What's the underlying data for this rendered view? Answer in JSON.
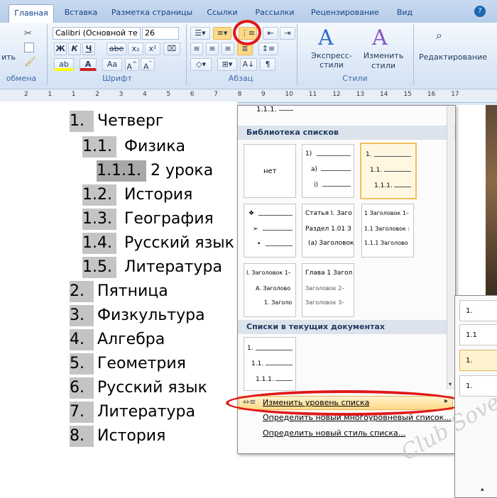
{
  "ribbon": {
    "tabs": [
      {
        "label": "Главная",
        "active": true
      },
      {
        "label": "Вставка"
      },
      {
        "label": "Разметка страницы"
      },
      {
        "label": "Ссылки"
      },
      {
        "label": "Рассылки"
      },
      {
        "label": "Рецензирование"
      },
      {
        "label": "Вид"
      }
    ],
    "left_cut_label": "ить",
    "font_name": "Calibri (Основной те",
    "font_size": "26",
    "font_buttons": [
      "Ж",
      "К",
      "Ч",
      "abe",
      "x₂",
      "x²",
      "Aa"
    ],
    "express_styles": "Экспресс-стили",
    "change_styles": "Изменить стили",
    "editing": "Редактирование",
    "groups": {
      "clipboard": "обмена",
      "font": "Шрифт",
      "paragraph": "Абзац",
      "styles": "Стили"
    }
  },
  "ruler": {
    "numbers": [
      "2",
      "1",
      "1",
      "2",
      "3",
      "4",
      "5",
      "6",
      "7",
      "8",
      "9",
      "10",
      "11",
      "12",
      "13",
      "14",
      "15",
      "16",
      "17"
    ]
  },
  "document": {
    "items": [
      {
        "num": "1.",
        "text": "Четверг"
      },
      {
        "num": "1.1.",
        "text": "Физика"
      },
      {
        "num": "1.1.1.",
        "text": "2 урока"
      },
      {
        "num": "1.2.",
        "text": "История"
      },
      {
        "num": "1.3.",
        "text": "География"
      },
      {
        "num": "1.4.",
        "text": "Русский язык"
      },
      {
        "num": "1.5.",
        "text": "Литература"
      },
      {
        "num": "2.",
        "text": "Пятница"
      },
      {
        "num": "3.",
        "text": "Физкультура"
      },
      {
        "num": "4.",
        "text": "Алгебра"
      },
      {
        "num": "5.",
        "text": "Геометрия"
      },
      {
        "num": "6.",
        "text": "Русский язык"
      },
      {
        "num": "7.",
        "text": "Литература"
      },
      {
        "num": "8.",
        "text": "История"
      }
    ]
  },
  "menu": {
    "top_partial": "1.1.1.",
    "library_header": "Библиотека списков",
    "none_label": "нет",
    "tile_numbered": [
      "1)",
      "a)",
      "i)"
    ],
    "tile_multilevel": [
      "1.",
      "1.1.",
      "1.1.1."
    ],
    "tile_article": [
      "Статья I. Заго",
      "Раздел 1.01 З",
      "(a) Заголовок"
    ],
    "tile_heading_num": [
      "1 Заголовок 1–",
      "1.1 Заголовок :",
      "1.1.1 Заголово"
    ],
    "tile_roman": [
      "I. Заголовок 1–",
      "A. Заголово",
      "1. Заголо"
    ],
    "tile_chapter": [
      "Глава 1 Загол",
      "Заголовок 2–",
      "Заголовок 3–"
    ],
    "current_header": "Списки в текущих документах",
    "current_tile": [
      "1.",
      "1.1.",
      "1.1.1."
    ],
    "items": [
      "Изменить уровень списка",
      "Определить новый многоуровневый список...",
      "Определить новый стиль списка..."
    ]
  },
  "submenu": {
    "items": [
      "1.",
      "1.1",
      "1.",
      "1."
    ]
  },
  "watermark": "Club Sovet",
  "colors": {
    "accent_red": "#e01818",
    "highlight": "#ffd985",
    "ribbon_text": "#15428b"
  }
}
